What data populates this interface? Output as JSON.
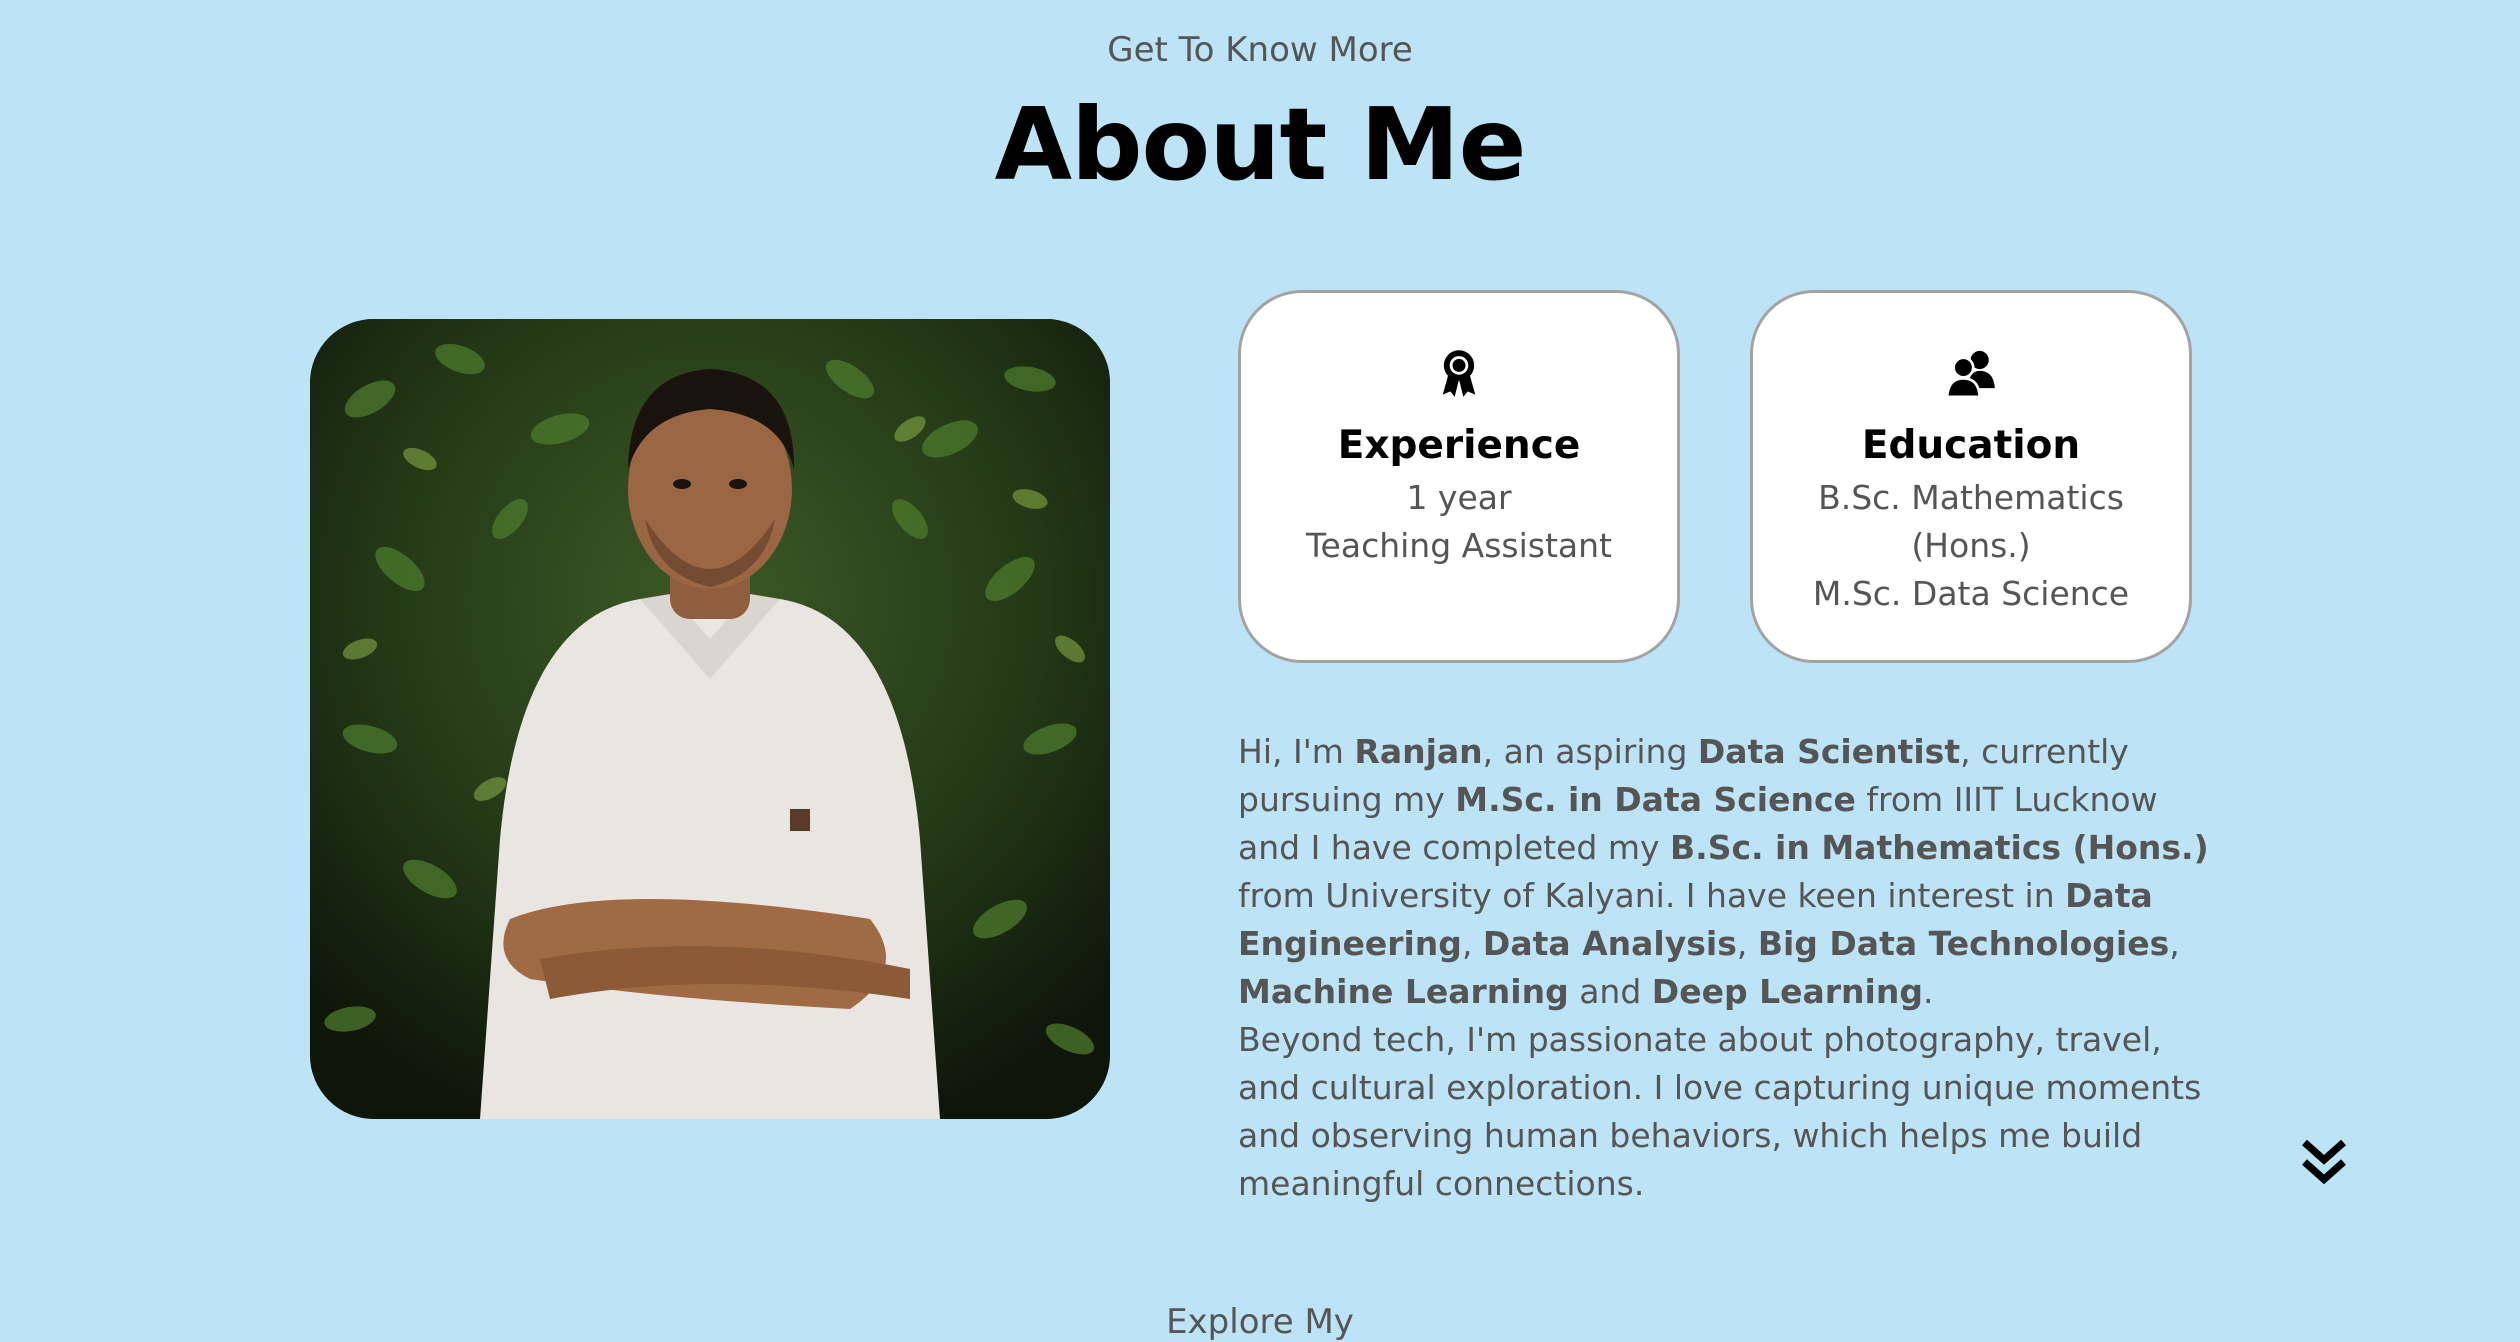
{
  "header": {
    "subtitle": "Get To Know More",
    "title": "About Me"
  },
  "profile_image": {
    "icon": "portrait-photo"
  },
  "cards": [
    {
      "icon": "award-ribbon-icon",
      "title": "Experience",
      "lines": [
        "1 year",
        "Teaching Assistant"
      ]
    },
    {
      "icon": "users-icon",
      "title": "Education",
      "lines": [
        "B.Sc. Mathematics",
        "(Hons.)",
        "M.Sc. Data Science"
      ]
    }
  ],
  "bio": {
    "p1": [
      {
        "text": "Hi, I'm ",
        "bold": false
      },
      {
        "text": "Ranjan",
        "bold": true
      },
      {
        "text": ", an aspiring ",
        "bold": false
      },
      {
        "text": "Data Scientist",
        "bold": true
      },
      {
        "text": ", currently pursuing my ",
        "bold": false
      },
      {
        "text": "M.Sc. in Data Science",
        "bold": true
      },
      {
        "text": " from IIIT Lucknow and I have completed my ",
        "bold": false
      },
      {
        "text": "B.Sc. in Mathematics (Hons.)",
        "bold": true
      },
      {
        "text": " from University of Kalyani. I have keen interest in ",
        "bold": false
      },
      {
        "text": "Data Engineering",
        "bold": true
      },
      {
        "text": ", ",
        "bold": false
      },
      {
        "text": "Data Analysis",
        "bold": true
      },
      {
        "text": ", ",
        "bold": false
      },
      {
        "text": "Big Data Technologies",
        "bold": true
      },
      {
        "text": ", ",
        "bold": false
      },
      {
        "text": "Machine Learning",
        "bold": true
      },
      {
        "text": " and ",
        "bold": false
      },
      {
        "text": "Deep Learning",
        "bold": true
      },
      {
        "text": ".",
        "bold": false
      }
    ],
    "p2": "Beyond tech, I'm passionate about photography, travel, and cultural exploration. I love capturing unique moments and observing human behaviors, which helps me build meaningful connections."
  },
  "scroll_arrow": {
    "icon": "double-chevron-down-icon"
  },
  "next_section": {
    "subtitle": "Explore My"
  },
  "colors": {
    "background": "#bde3f6",
    "card": "#ffffff",
    "card_border": "#a3a3a3",
    "text": "#555555",
    "heading": "#000000"
  }
}
